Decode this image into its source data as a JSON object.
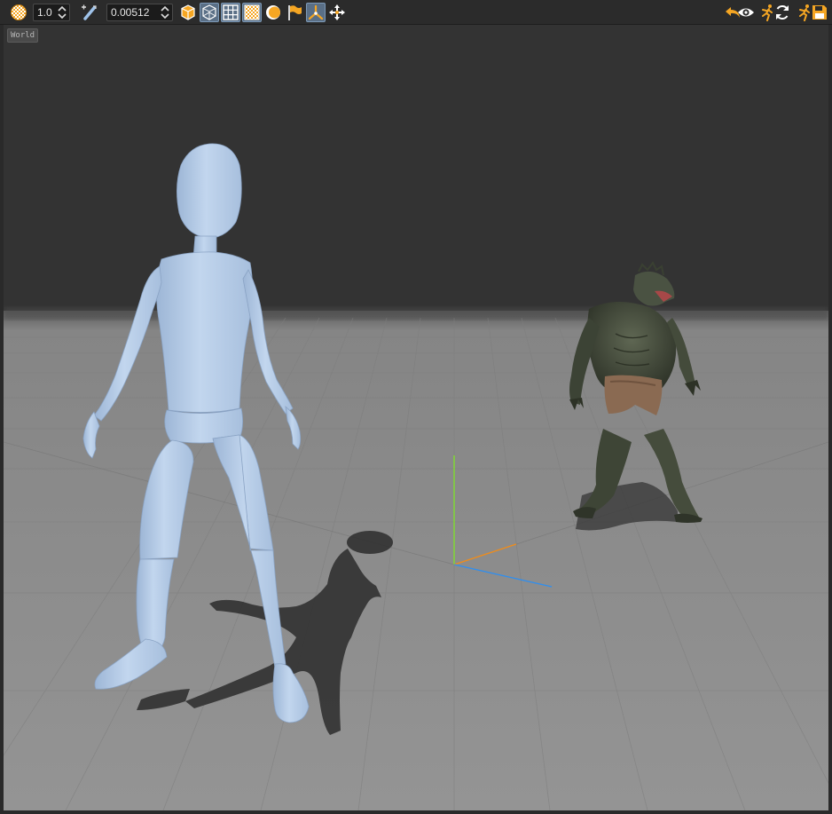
{
  "toolbar": {
    "scale_value": "1.0",
    "step_value": "0.00512",
    "left_icons": [
      "checker-sphere-icon",
      "bone-pen-icon",
      "solid-cube-icon",
      "wire-cube-icon",
      "grid-icon",
      "checker-floor-icon",
      "light-disk-icon",
      "flag-icon",
      "skeleton-axes-icon",
      "move-arrows-icon"
    ],
    "right_icons": [
      "undo-icon",
      "eye-icon",
      "run-person-icon",
      "refresh-icon",
      "run-save-icon",
      "save-icon"
    ],
    "accent_color": "#f5a623",
    "active_color": "#5a6f86"
  },
  "viewport": {
    "coordinate_space_label": "World",
    "sky_color": "#323232",
    "floor_color": "#8d8d8d",
    "mannequin_color": "#b4cbe8",
    "lizard_color": "#4b5242",
    "gizmo_axes": [
      "x",
      "y",
      "z"
    ]
  }
}
